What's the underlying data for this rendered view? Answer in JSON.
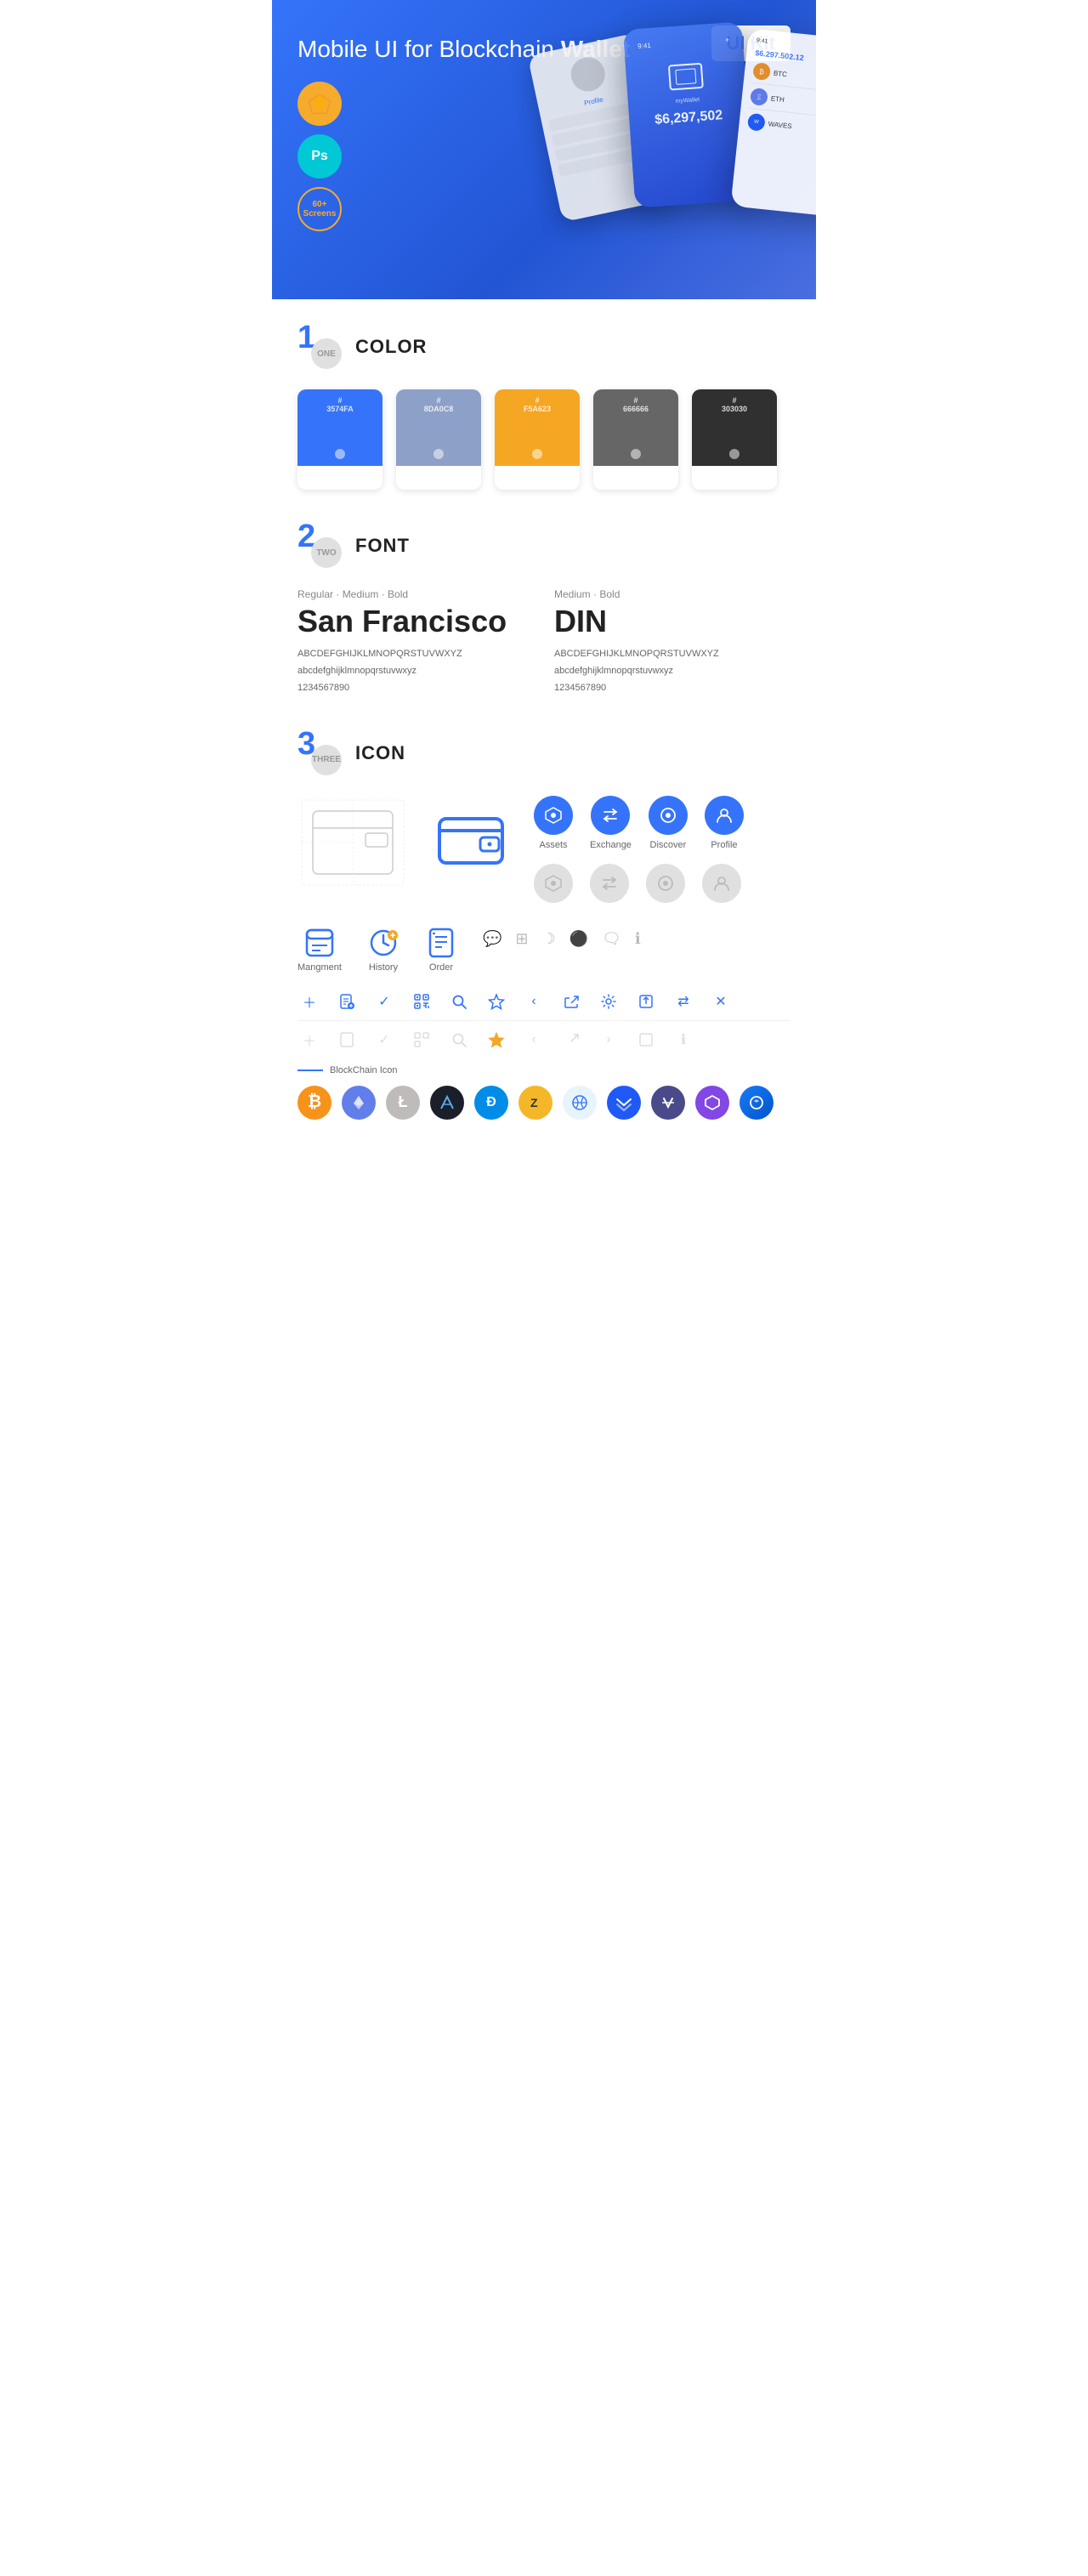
{
  "hero": {
    "title_normal": "Mobile UI for Blockchain ",
    "title_bold": "Wallet",
    "badge": "UI Kit",
    "badges": [
      {
        "id": "sketch",
        "label": "Sk",
        "type": "sketch"
      },
      {
        "id": "ps",
        "label": "Ps",
        "type": "ps"
      },
      {
        "id": "screens",
        "label": "60+\nScreens",
        "type": "screens"
      }
    ]
  },
  "sections": {
    "color": {
      "number": "1",
      "number_word": "ONE",
      "title": "COLOR",
      "swatches": [
        {
          "id": "blue",
          "hex": "#3574FA",
          "code": "#3574FA"
        },
        {
          "id": "grey-blue",
          "hex": "#8DA0C8",
          "code": "#8DA0C8"
        },
        {
          "id": "orange",
          "hex": "#F5A623",
          "code": "#F5A623"
        },
        {
          "id": "grey",
          "hex": "#666666",
          "code": "#666666"
        },
        {
          "id": "dark",
          "hex": "#303030",
          "code": "#303030"
        }
      ]
    },
    "font": {
      "number": "2",
      "number_word": "TWO",
      "title": "FONT",
      "fonts": [
        {
          "id": "sf",
          "style_label": "Regular · Medium · Bold",
          "name": "San Francisco",
          "uppercase": "ABCDEFGHIJKLMNOPQRSTUVWXYZ",
          "lowercase": "abcdefghijklmnopqrstuvwxyz",
          "numbers": "1234567890"
        },
        {
          "id": "din",
          "style_label": "Medium · Bold",
          "name": "DIN",
          "uppercase": "ABCDEFGHIJKLMNOPQRSTUVWXYZ",
          "lowercase": "abcdefghijklmnopqrstuvwxyz",
          "numbers": "1234567890"
        }
      ]
    },
    "icon": {
      "number": "3",
      "number_word": "THREE",
      "title": "ICON",
      "nav_icons": [
        {
          "id": "assets",
          "label": "Assets",
          "color": "#3574FA"
        },
        {
          "id": "exchange",
          "label": "Exchange",
          "color": "#3574FA"
        },
        {
          "id": "discover",
          "label": "Discover",
          "color": "#3574FA"
        },
        {
          "id": "profile",
          "label": "Profile",
          "color": "#3574FA"
        }
      ],
      "tab_icons": [
        {
          "id": "management",
          "label": "Mangment"
        },
        {
          "id": "history",
          "label": "History"
        },
        {
          "id": "order",
          "label": "Order"
        }
      ],
      "small_icons": [
        "+",
        "doc",
        "✓",
        "qr",
        "search",
        "star",
        "<",
        "share",
        "gear",
        "box",
        "⇄",
        "×"
      ],
      "blockchain_label": "BlockChain Icon",
      "crypto_coins": [
        {
          "id": "btc",
          "symbol": "₿",
          "bg": "#F7931A",
          "color": "#fff"
        },
        {
          "id": "eth",
          "symbol": "Ξ",
          "bg": "#627EEA",
          "color": "#fff"
        },
        {
          "id": "ltc",
          "symbol": "Ł",
          "bg": "#BFBBBB",
          "color": "#fff"
        },
        {
          "id": "feather",
          "symbol": "◆",
          "bg": "#1B1F2A",
          "color": "#55ACEE"
        },
        {
          "id": "dash",
          "symbol": "Đ",
          "bg": "#008CE7",
          "color": "#fff"
        },
        {
          "id": "zcash",
          "symbol": "Z",
          "bg": "#F4B728",
          "color": "#fff"
        },
        {
          "id": "grid",
          "symbol": "⊞",
          "bg": "#E8F4FC",
          "color": "#3574FA"
        },
        {
          "id": "waves",
          "symbol": "≋",
          "bg": "#1F5AF6",
          "color": "#fff"
        },
        {
          "id": "nano",
          "symbol": "N",
          "bg": "#4A90D9",
          "color": "#fff"
        },
        {
          "id": "polygon",
          "symbol": "⬡",
          "bg": "#8247E5",
          "color": "#fff"
        },
        {
          "id": "unknown",
          "symbol": "◉",
          "bg": "#1A7AF8",
          "color": "#fff"
        }
      ]
    }
  }
}
